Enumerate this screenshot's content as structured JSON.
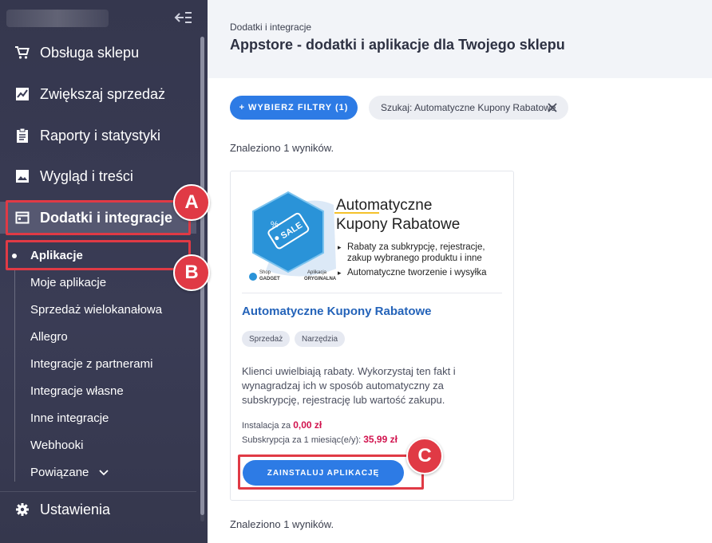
{
  "sidebar": {
    "main_items": [
      {
        "label": "Obsługa sklepu",
        "icon": "cart-icon"
      },
      {
        "label": "Zwiększaj sprzedaż",
        "icon": "chart-icon"
      },
      {
        "label": "Raporty i statystyki",
        "icon": "clipboard-icon"
      },
      {
        "label": "Wygląd i treści",
        "icon": "image-icon"
      },
      {
        "label": "Dodatki i integracje",
        "icon": "window-icon"
      }
    ],
    "sub_items": [
      "Aplikacje",
      "Moje aplikacje",
      "Sprzedaż wielokanałowa",
      "Allegro",
      "Integracje z partnerami",
      "Integracje własne",
      "Inne integracje",
      "Webhooki",
      "Powiązane"
    ],
    "settings_label": "Ustawienia"
  },
  "header": {
    "breadcrumb": "Dodatki i integracje",
    "title": "Appstore - dodatki i aplikacje dla Twojego sklepu"
  },
  "filters": {
    "button_label": "+ WYBIERZ FILTRY (1)",
    "search_chip": "Szukaj: Automatyczne Kupony Rabatowe"
  },
  "results_text": "Znaleziono 1 wyników.",
  "card": {
    "banner": {
      "title_line1": "Automatyczne",
      "title_line2": "Kupony Rabatowe",
      "bullets": [
        "Rabaty za subkrypcję, rejestracje,",
        "zakup wybranego produktu i inne",
        "Automatyczne tworzenie i wysyłka"
      ],
      "sale_text": "SALE",
      "shop_label": "Shop",
      "brand_label": "GADGET",
      "app_label": "Aplikacja",
      "original_label": "ORYGINALNA"
    },
    "title": "Automatyczne Kupony Rabatowe",
    "tags": [
      "Sprzedaż",
      "Narzędzia"
    ],
    "description": "Klienci uwielbiają rabaty. Wykorzystaj ten fakt i wynagradzaj ich w sposób automatyczny za subskrypcję, rejestrację lub wartość zakupu.",
    "install_prefix": "Instalacja za",
    "install_price": "0,00 zł",
    "subscription_prefix": "Subskrypcja za 1 miesiąc(e/y):",
    "subscription_price": "35,99 zł",
    "install_button": "ZAINSTALUJ APLIKACJĘ"
  },
  "annotations": {
    "marker_a": "A",
    "marker_b": "B",
    "marker_c": "C",
    "color": "#e03a45"
  },
  "colors": {
    "sidebar_bg": "#3a3c55",
    "accent_blue": "#2d7be5",
    "price_red": "#d1134e",
    "link_blue": "#2463b9"
  }
}
